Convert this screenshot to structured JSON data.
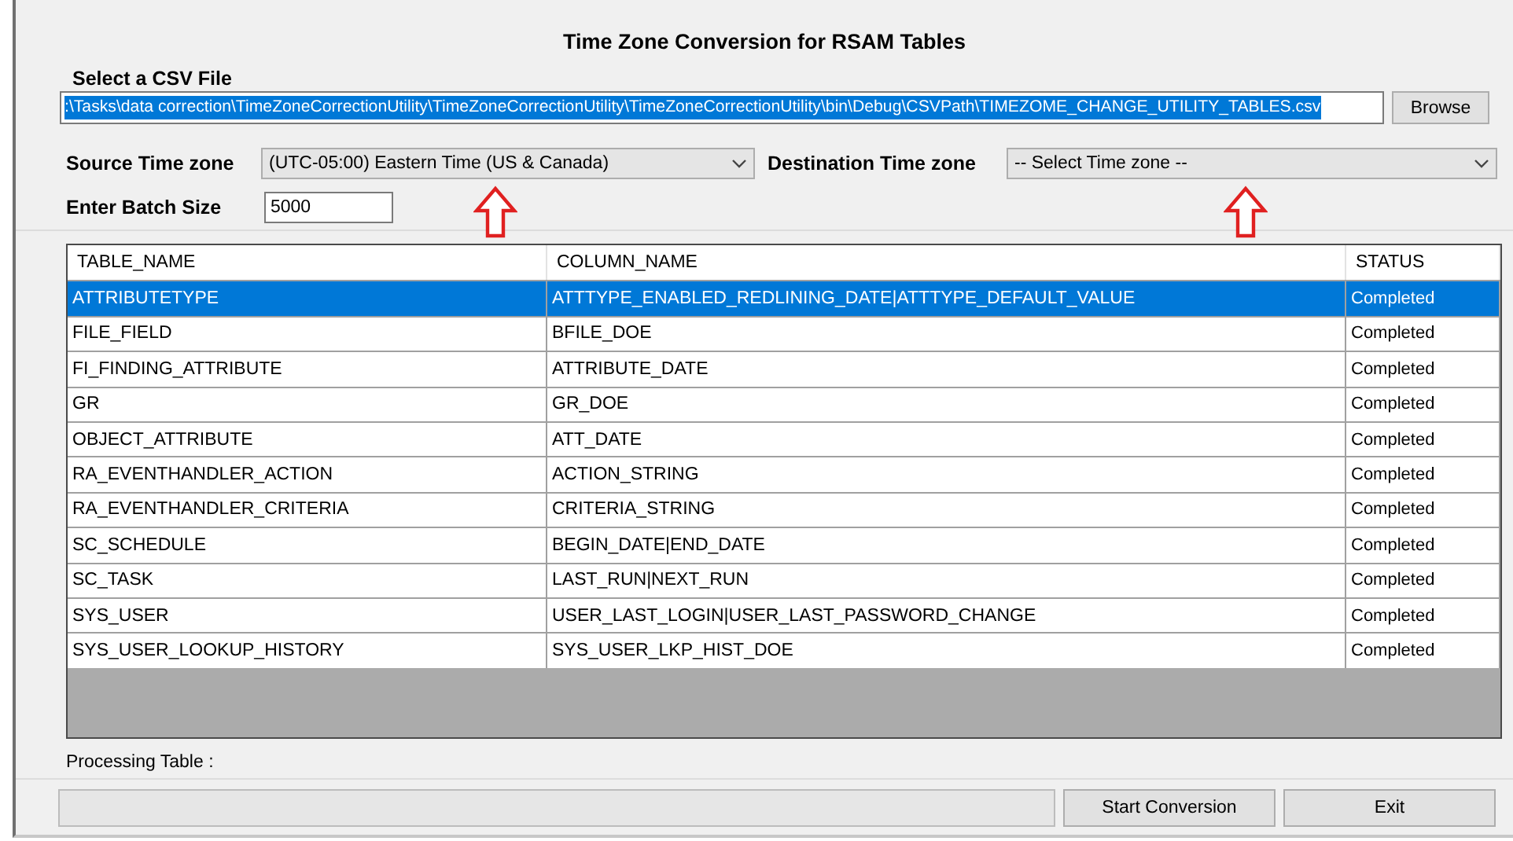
{
  "window": {
    "title": "Time Zone Conversion for RSAM Tables"
  },
  "csv": {
    "label": "Select a CSV File",
    "value": ":\\Tasks\\data correction\\TimeZoneCorrectionUtility\\TimeZoneCorrectionUtility\\TimeZoneCorrectionUtility\\bin\\Debug\\CSVPath\\TIMEZOME_CHANGE_UTILITY_TABLES.csv",
    "browse": "Browse"
  },
  "source": {
    "label": "Source Time zone",
    "value": "(UTC-05:00) Eastern Time (US & Canada)"
  },
  "destination": {
    "label": "Destination Time zone",
    "value": "-- Select Time zone --"
  },
  "batch": {
    "label": "Enter Batch Size",
    "value": "5000"
  },
  "table": {
    "columns": [
      "TABLE_NAME",
      "COLUMN_NAME",
      "STATUS"
    ],
    "rows": [
      {
        "cells": [
          "ATTRIBUTETYPE",
          "ATTTYPE_ENABLED_REDLINING_DATE|ATTTYPE_DEFAULT_VALUE",
          "Completed"
        ],
        "selected": true
      },
      {
        "cells": [
          "FILE_FIELD",
          "BFILE_DOE",
          "Completed"
        ],
        "selected": false
      },
      {
        "cells": [
          "FI_FINDING_ATTRIBUTE",
          "ATTRIBUTE_DATE",
          "Completed"
        ],
        "selected": false
      },
      {
        "cells": [
          "GR",
          "GR_DOE",
          "Completed"
        ],
        "selected": false
      },
      {
        "cells": [
          "OBJECT_ATTRIBUTE",
          "ATT_DATE",
          "Completed"
        ],
        "selected": false
      },
      {
        "cells": [
          "RA_EVENTHANDLER_ACTION",
          "ACTION_STRING",
          "Completed"
        ],
        "selected": false
      },
      {
        "cells": [
          "RA_EVENTHANDLER_CRITERIA",
          "CRITERIA_STRING",
          "Completed"
        ],
        "selected": false
      },
      {
        "cells": [
          "SC_SCHEDULE",
          "BEGIN_DATE|END_DATE",
          "Completed"
        ],
        "selected": false
      },
      {
        "cells": [
          "SC_TASK",
          "LAST_RUN|NEXT_RUN",
          "Completed"
        ],
        "selected": false
      },
      {
        "cells": [
          "SYS_USER",
          "USER_LAST_LOGIN|USER_LAST_PASSWORD_CHANGE",
          "Completed"
        ],
        "selected": false
      },
      {
        "cells": [
          "SYS_USER_LOOKUP_HISTORY",
          "SYS_USER_LKP_HIST_DOE",
          "Completed"
        ],
        "selected": false
      }
    ]
  },
  "processing_label": "Processing Table :",
  "progress": {
    "level": 0
  },
  "buttons": [
    "Start Conversion",
    "Exit"
  ]
}
